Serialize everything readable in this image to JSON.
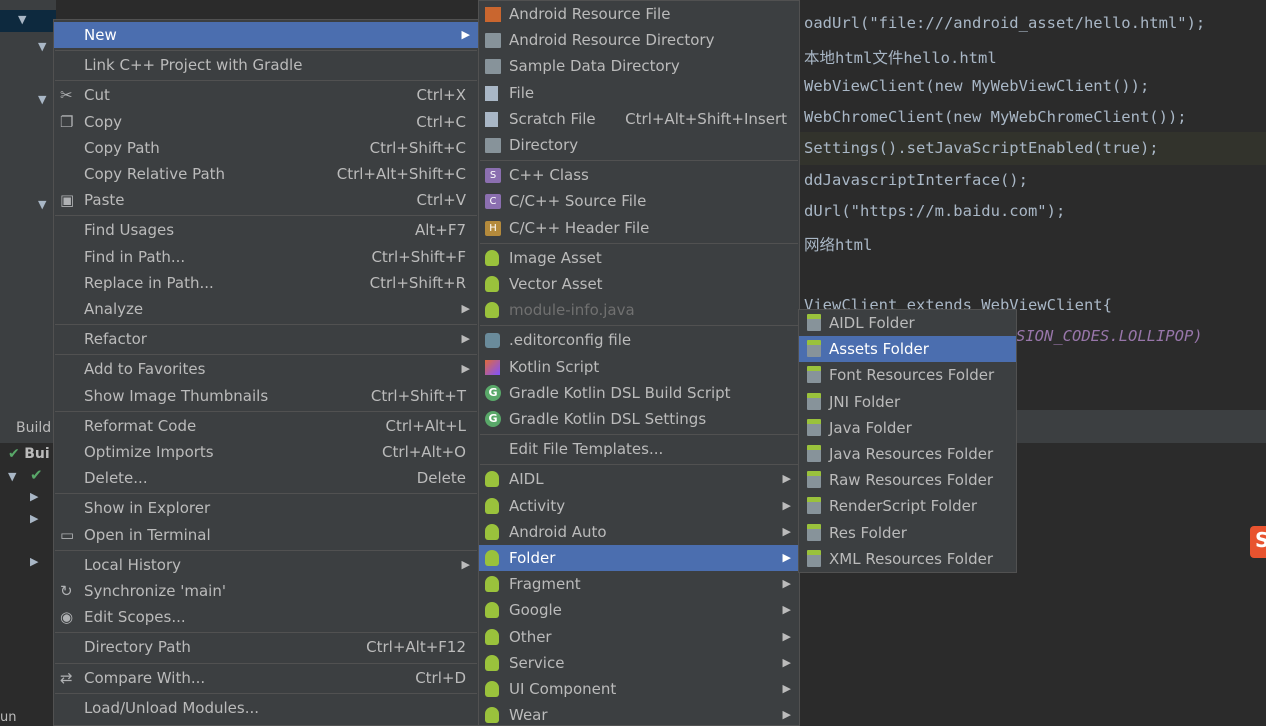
{
  "editor": {
    "lines": [
      {
        "t": "oadUrl(\"file:///android_asset/hello.html\");"
      },
      {
        "t": "本地html文件hello.html"
      },
      {
        "t": "WebViewClient(new MyWebViewClient());"
      },
      {
        "t": "WebChromeClient(new MyWebChromeClient());"
      },
      {
        "t": "Settings().setJavaScriptEnabled(true);"
      },
      {
        "t": "ddJavascriptInterface();"
      },
      {
        "t": "dUrl(\"https://m.baidu.com\");"
      },
      {
        "t": "网络html"
      },
      {
        "t": "ViewClient extends WebViewClient{"
      },
      {
        "t": "SION_CODES.LOLLIPOP)"
      }
    ]
  },
  "project": {
    "folder": "main"
  },
  "bottom": {
    "tab": "Build",
    "run_item": "Bui",
    "run_label": "un"
  },
  "context_menu": {
    "items": [
      {
        "label": "New",
        "sub": true,
        "sel": true
      },
      {
        "sep": true
      },
      {
        "label": "Link C++ Project with Gradle"
      },
      {
        "sep": true
      },
      {
        "label": "Cut",
        "sc": "Ctrl+X",
        "icon": "scissors-icon",
        "g": "✂"
      },
      {
        "label": "Copy",
        "sc": "Ctrl+C",
        "icon": "copy-icon",
        "g": "❐"
      },
      {
        "label": "Copy Path",
        "sc": "Ctrl+Shift+C"
      },
      {
        "label": "Copy Relative Path",
        "sc": "Ctrl+Alt+Shift+C"
      },
      {
        "label": "Paste",
        "sc": "Ctrl+V",
        "icon": "paste-icon",
        "g": "▣"
      },
      {
        "sep": true
      },
      {
        "label": "Find Usages",
        "sc": "Alt+F7"
      },
      {
        "label": "Find in Path...",
        "sc": "Ctrl+Shift+F"
      },
      {
        "label": "Replace in Path...",
        "sc": "Ctrl+Shift+R"
      },
      {
        "label": "Analyze",
        "sub": true
      },
      {
        "sep": true
      },
      {
        "label": "Refactor",
        "sub": true
      },
      {
        "sep": true
      },
      {
        "label": "Add to Favorites",
        "sub": true
      },
      {
        "label": "Show Image Thumbnails",
        "sc": "Ctrl+Shift+T"
      },
      {
        "sep": true
      },
      {
        "label": "Reformat Code",
        "sc": "Ctrl+Alt+L"
      },
      {
        "label": "Optimize Imports",
        "sc": "Ctrl+Alt+O"
      },
      {
        "label": "Delete...",
        "sc": "Delete"
      },
      {
        "sep": true
      },
      {
        "label": "Show in Explorer"
      },
      {
        "label": "Open in Terminal",
        "icon": "terminal-icon",
        "g": "▭"
      },
      {
        "sep": true
      },
      {
        "label": "Local History",
        "sub": true
      },
      {
        "label": "Synchronize 'main'",
        "icon": "sync-icon",
        "g": "↻"
      },
      {
        "label": "Edit Scopes...",
        "icon": "scope-icon",
        "g": "◉"
      },
      {
        "sep": true
      },
      {
        "label": "Directory Path",
        "sc": "Ctrl+Alt+F12"
      },
      {
        "sep": true
      },
      {
        "label": "Compare With...",
        "sc": "Ctrl+D",
        "icon": "compare-icon",
        "g": "⇄"
      },
      {
        "sep": true
      },
      {
        "label": "Load/Unload Modules..."
      }
    ]
  },
  "new_menu": {
    "items": [
      {
        "label": "Android Resource File",
        "icon": "res"
      },
      {
        "label": "Android Resource Directory",
        "icon": "folder"
      },
      {
        "label": "Sample Data Directory",
        "icon": "folder"
      },
      {
        "label": "File",
        "icon": "file"
      },
      {
        "label": "Scratch File",
        "sc": "Ctrl+Alt+Shift+Insert",
        "icon": "file"
      },
      {
        "label": "Directory",
        "icon": "folder"
      },
      {
        "sep": true
      },
      {
        "label": "C++ Class",
        "icon": "c",
        "g": "S"
      },
      {
        "label": "C/C++ Source File",
        "icon": "c",
        "g": "C"
      },
      {
        "label": "C/C++ Header File",
        "icon": "h",
        "g": "H"
      },
      {
        "sep": true
      },
      {
        "label": "Image Asset",
        "icon": "droid"
      },
      {
        "label": "Vector Asset",
        "icon": "droid"
      },
      {
        "label": "module-info.java",
        "icon": "droid",
        "dis": true
      },
      {
        "sep": true
      },
      {
        "label": ".editorconfig file",
        "icon": "cfg"
      },
      {
        "label": "Kotlin Script",
        "icon": "kt"
      },
      {
        "label": "Gradle Kotlin DSL Build Script",
        "icon": "g",
        "g": "G"
      },
      {
        "label": "Gradle Kotlin DSL Settings",
        "icon": "g",
        "g": "G"
      },
      {
        "sep": true
      },
      {
        "label": "Edit File Templates..."
      },
      {
        "sep": true
      },
      {
        "label": "AIDL",
        "icon": "droid",
        "sub": true
      },
      {
        "label": "Activity",
        "icon": "droid",
        "sub": true
      },
      {
        "label": "Android Auto",
        "icon": "droid",
        "sub": true
      },
      {
        "label": "Folder",
        "icon": "droid",
        "sub": true,
        "sel": true
      },
      {
        "label": "Fragment",
        "icon": "droid",
        "sub": true
      },
      {
        "label": "Google",
        "icon": "droid",
        "sub": true
      },
      {
        "label": "Other",
        "icon": "droid",
        "sub": true
      },
      {
        "label": "Service",
        "icon": "droid",
        "sub": true
      },
      {
        "label": "UI Component",
        "icon": "droid",
        "sub": true
      },
      {
        "label": "Wear",
        "icon": "droid",
        "sub": true
      }
    ]
  },
  "folder_menu": {
    "items": [
      {
        "label": "AIDL Folder"
      },
      {
        "label": "Assets Folder",
        "sel": true
      },
      {
        "label": "Font Resources Folder"
      },
      {
        "label": "JNI Folder"
      },
      {
        "label": "Java Folder"
      },
      {
        "label": "Java Resources Folder"
      },
      {
        "label": "Raw Resources Folder"
      },
      {
        "label": "RenderScript Folder"
      },
      {
        "label": "Res Folder"
      },
      {
        "label": "XML Resources Folder"
      }
    ]
  },
  "colors": {
    "menu_bg": "#3c3f41",
    "selection": "#4b6eaf",
    "android_green": "#9ac23c"
  }
}
